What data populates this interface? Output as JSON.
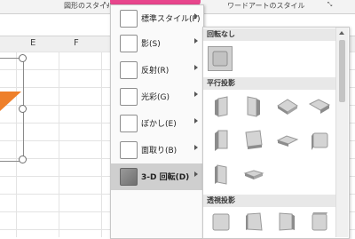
{
  "ribbon": {
    "shape_styles_label": "図形のスタイル",
    "wordart_styles_label": "ワードアートのスタイル",
    "launcher_glyph": "⤡"
  },
  "columns": [
    "E",
    "F"
  ],
  "menu": {
    "items": [
      {
        "label": "標準スタイル(P)",
        "name": "preset",
        "active": false
      },
      {
        "label": "影(S)",
        "name": "shadow",
        "active": false
      },
      {
        "label": "反射(R)",
        "name": "reflection",
        "active": false
      },
      {
        "label": "光彩(G)",
        "name": "glow",
        "active": false
      },
      {
        "label": "ぼかし(E)",
        "name": "soft-edges",
        "active": false
      },
      {
        "label": "面取り(B)",
        "name": "bevel",
        "active": false
      },
      {
        "label": "3-D 回転(D)",
        "name": "3d-rotation",
        "active": true
      }
    ]
  },
  "gallery": {
    "sections": [
      {
        "title": "回転なし"
      },
      {
        "title": "平行投影"
      },
      {
        "title": "透視投影"
      }
    ]
  },
  "colors": {
    "accent_pink": "#e8468d",
    "shape_orange": "#ee7f2a"
  }
}
